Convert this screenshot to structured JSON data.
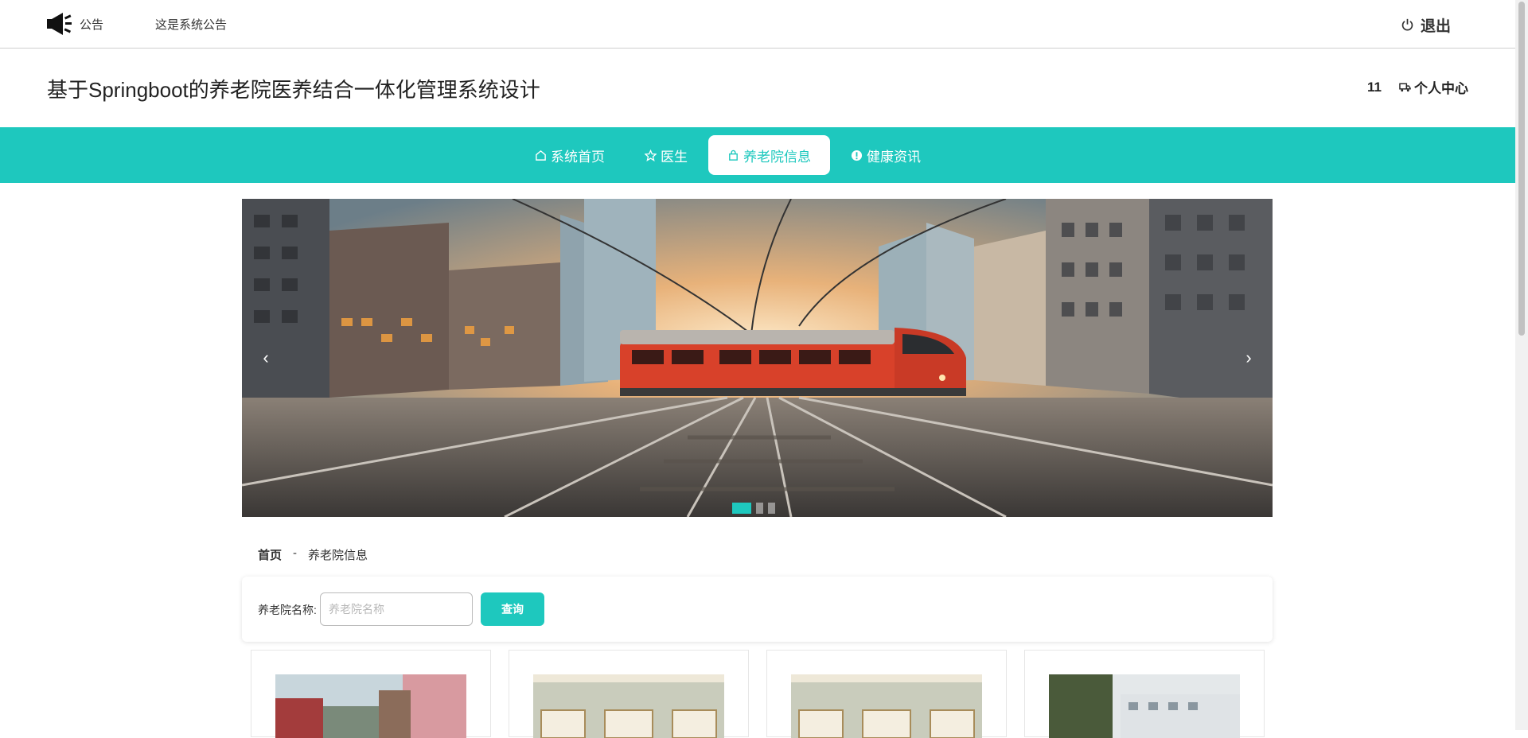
{
  "notice": {
    "label": "公告",
    "text": "这是系统公告",
    "icon": "speaker-icon"
  },
  "logout": {
    "label": "退出",
    "icon": "power-icon"
  },
  "header": {
    "title": "基于Springboot的养老院医养结合一体化管理系统设计",
    "user_id": "11",
    "personal_center": "个人中心"
  },
  "nav": {
    "items": [
      {
        "label": "系统首页",
        "icon": "home-icon"
      },
      {
        "label": "医生",
        "icon": "star-icon"
      },
      {
        "label": "养老院信息",
        "icon": "bag-icon",
        "active": true
      },
      {
        "label": "健康资讯",
        "icon": "info-icon"
      }
    ]
  },
  "banner": {
    "prev": "‹",
    "next": "›",
    "slides": 3,
    "active_slide": 1
  },
  "breadcrumb": {
    "home": "首页",
    "separator": "-",
    "current": "养老院信息"
  },
  "search": {
    "label": "养老院名称:",
    "placeholder": "养老院名称",
    "value": "",
    "button": "查询"
  },
  "colors": {
    "accent": "#1ec8be",
    "nav_bg": "#1ec8be"
  }
}
